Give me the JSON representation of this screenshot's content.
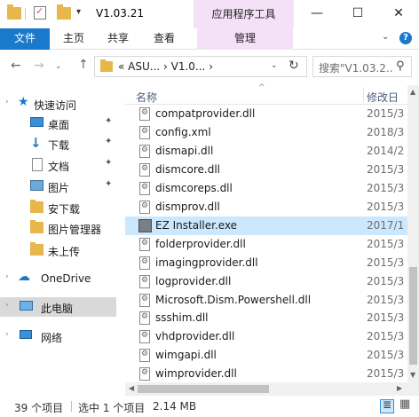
{
  "window": {
    "title": "V1.03.21",
    "context_tab": "应用程序工具",
    "quick_access_dropdown": "▾",
    "min_glyph": "—",
    "max_glyph": "☐",
    "close_glyph": "✕"
  },
  "ribbon": {
    "file": "文件",
    "home": "主页",
    "share": "共享",
    "view": "查看",
    "manage": "管理",
    "collapse_glyph": "⌄",
    "help_glyph": "?"
  },
  "address": {
    "back_glyph": "←",
    "forward_glyph": "→",
    "recent_glyph": "⌄",
    "up_glyph": "↑",
    "path": "« ASU... › V1.0... ›",
    "dropdown_glyph": "⌄",
    "refresh_glyph": "↻"
  },
  "search": {
    "placeholder": "搜索\"V1.03.2...",
    "icon_glyph": "⚲"
  },
  "nav": {
    "items": [
      {
        "label": "快速访问",
        "icon": "star-icon",
        "glyph": "★",
        "pinned": false,
        "expander": "›"
      },
      {
        "label": "桌面",
        "icon": "desktop-icon",
        "pinned": true
      },
      {
        "label": "下载",
        "icon": "download-icon",
        "glyph": "↓",
        "pinned": true
      },
      {
        "label": "文档",
        "icon": "document-icon",
        "pinned": true
      },
      {
        "label": "图片",
        "icon": "pictures-icon",
        "pinned": true
      },
      {
        "label": "安下载",
        "icon": "folder-icon",
        "pinned": false
      },
      {
        "label": "图片管理器",
        "icon": "folder-icon",
        "pinned": false
      },
      {
        "label": "未上传",
        "icon": "folder-icon",
        "pinned": false
      },
      {
        "label": "OneDrive",
        "icon": "cloud-icon",
        "glyph": "☁",
        "pinned": false,
        "expander": "›"
      },
      {
        "label": "此电脑",
        "icon": "computer-icon",
        "pinned": false,
        "expander": "›"
      },
      {
        "label": "网络",
        "icon": "network-icon",
        "pinned": false,
        "expander": "›"
      }
    ],
    "pin_glyph": "📌"
  },
  "columns": {
    "name": "名称",
    "date": "修改日",
    "sort_glyph": "^"
  },
  "files": [
    {
      "name": "compatprovider.dll",
      "date": "2015/3",
      "type": "dll"
    },
    {
      "name": "config.xml",
      "date": "2018/3",
      "type": "xml"
    },
    {
      "name": "dismapi.dll",
      "date": "2014/2",
      "type": "dll"
    },
    {
      "name": "dismcore.dll",
      "date": "2015/3",
      "type": "dll"
    },
    {
      "name": "dismcoreps.dll",
      "date": "2015/3",
      "type": "dll"
    },
    {
      "name": "dismprov.dll",
      "date": "2015/3",
      "type": "dll"
    },
    {
      "name": "EZ Installer.exe",
      "date": "2017/1",
      "type": "exe",
      "selected": true
    },
    {
      "name": "folderprovider.dll",
      "date": "2015/3",
      "type": "dll"
    },
    {
      "name": "imagingprovider.dll",
      "date": "2015/3",
      "type": "dll"
    },
    {
      "name": "logprovider.dll",
      "date": "2015/3",
      "type": "dll"
    },
    {
      "name": "Microsoft.Dism.Powershell.dll",
      "date": "2015/3",
      "type": "dll"
    },
    {
      "name": "ssshim.dll",
      "date": "2015/3",
      "type": "dll"
    },
    {
      "name": "vhdprovider.dll",
      "date": "2015/3",
      "type": "dll"
    },
    {
      "name": "wimgapi.dll",
      "date": "2015/3",
      "type": "dll"
    },
    {
      "name": "wimprovider.dll",
      "date": "2015/3",
      "type": "dll"
    }
  ],
  "scroll": {
    "up_glyph": "▲",
    "down_glyph": "▼",
    "left_glyph": "◀",
    "right_glyph": "▶"
  },
  "status": {
    "item_count": "39 个项目",
    "selected": "选中 1 个项目",
    "size": "2.14 MB"
  },
  "colors": {
    "accent": "#1979ca",
    "context_tab": "#f4e1f7",
    "selection": "#cce8ff"
  }
}
